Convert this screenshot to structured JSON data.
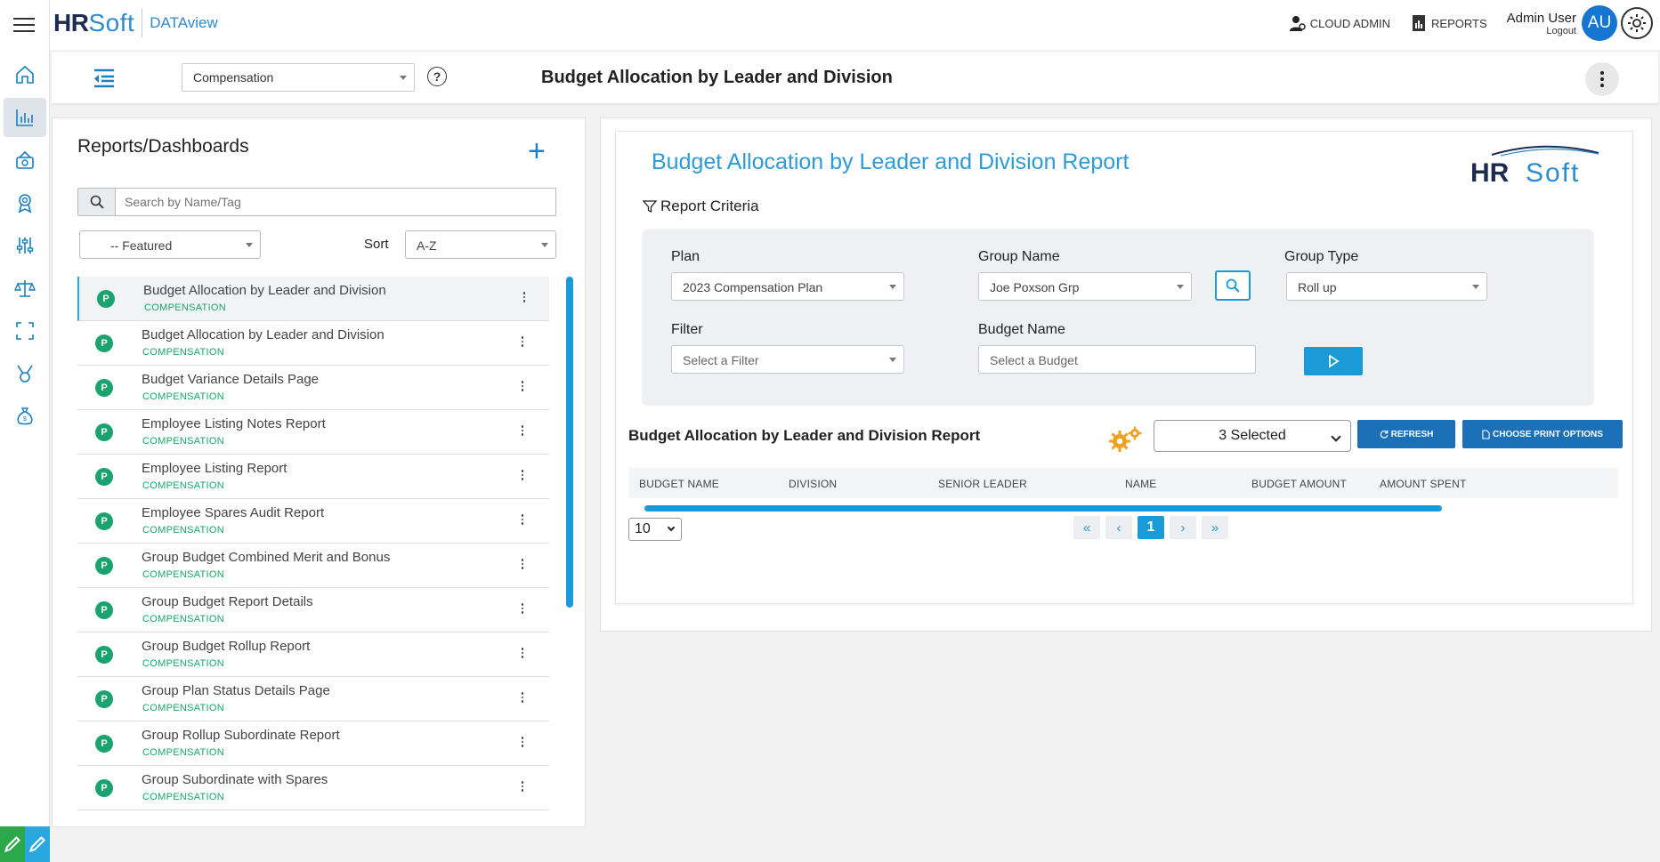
{
  "app": {
    "logo_hr": "HR",
    "logo_soft": "Soft",
    "product": "DATAview"
  },
  "topbar": {
    "cloud_admin": "CLOUD ADMIN",
    "reports": "REPORTS",
    "user_name": "Admin User",
    "logout": "Logout",
    "avatar_initials": "AU"
  },
  "subbar": {
    "module": "Compensation",
    "help": "?",
    "page_title": "Budget Allocation by Leader and Division"
  },
  "left": {
    "title": "Reports/Dashboards",
    "add": "+",
    "search_placeholder": "Search by Name/Tag",
    "featured": "-- Featured",
    "sort_label": "Sort",
    "sort_value": "A-Z",
    "items": [
      {
        "title": "Budget Allocation by Leader and Division",
        "tag": "COMPENSATION"
      },
      {
        "title": "Budget Allocation by Leader and Division",
        "tag": "COMPENSATION"
      },
      {
        "title": "Budget Variance Details Page",
        "tag": "COMPENSATION"
      },
      {
        "title": "Employee Listing Notes Report",
        "tag": "COMPENSATION"
      },
      {
        "title": "Employee Listing Report",
        "tag": "COMPENSATION"
      },
      {
        "title": "Employee Spares Audit Report",
        "tag": "COMPENSATION"
      },
      {
        "title": "Group Budget Combined Merit and Bonus",
        "tag": "COMPENSATION"
      },
      {
        "title": "Group Budget Report Details",
        "tag": "COMPENSATION"
      },
      {
        "title": "Group Budget Rollup Report",
        "tag": "COMPENSATION"
      },
      {
        "title": "Group Plan Status Details Page",
        "tag": "COMPENSATION"
      },
      {
        "title": "Group Rollup Subordinate Report",
        "tag": "COMPENSATION"
      },
      {
        "title": "Group Subordinate with Spares",
        "tag": "COMPENSATION"
      }
    ],
    "badge_letter": "P"
  },
  "report": {
    "title": "Budget Allocation by Leader and Division Report",
    "logo_hr": "HR",
    "logo_soft": "Soft",
    "criteria_label": "Report Criteria",
    "plan_label": "Plan",
    "plan_value": "2023 Compensation Plan",
    "group_name_label": "Group Name",
    "group_name_value": "Joe Poxson Grp",
    "group_type_label": "Group Type",
    "group_type_value": "Roll up",
    "filter_label": "Filter",
    "filter_placeholder": "Select a Filter",
    "budget_name_label": "Budget Name",
    "budget_name_placeholder": "Select a Budget",
    "table_title": "Budget Allocation by Leader and Division Report",
    "columns_selected": "3 Selected",
    "refresh_label": "REFRESH",
    "print_label": "CHOOSE PRINT OPTIONS",
    "columns": [
      "BUDGET NAME",
      "DIVISION",
      "SENIOR LEADER",
      "NAME",
      "BUDGET AMOUNT",
      "AMOUNT SPENT"
    ],
    "page_size": "10",
    "current_page": "1"
  },
  "colors": {
    "accent": "#1a9ad6",
    "primary_button": "#1b70b8",
    "tag_green": "#16a86a",
    "avatar_blue": "#1476d1"
  }
}
